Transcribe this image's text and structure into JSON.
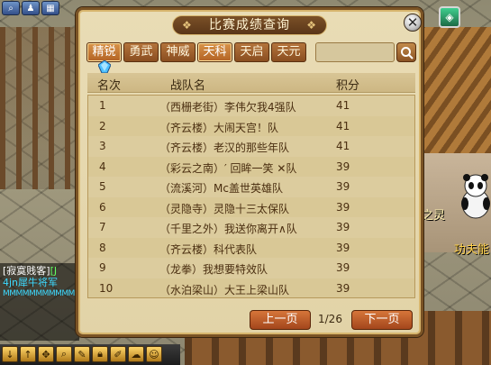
{
  "dialog": {
    "title": "比赛成绩查询",
    "close_label": "✕",
    "tabs": [
      {
        "label": "精锐",
        "active": true
      },
      {
        "label": "勇武",
        "active": false
      },
      {
        "label": "神威",
        "active": false
      },
      {
        "label": "天科",
        "active": true
      },
      {
        "label": "天启",
        "active": false
      },
      {
        "label": "天元",
        "active": false
      }
    ],
    "search": {
      "placeholder": "",
      "value": ""
    },
    "columns": {
      "rank": "名次",
      "team": "战队名",
      "score": "积分"
    },
    "rows": [
      {
        "rank": "1",
        "team": "（西栅老街）李伟欠我4强队",
        "score": "41"
      },
      {
        "rank": "2",
        "team": "（齐云楼）大闹天宫！队",
        "score": "41"
      },
      {
        "rank": "3",
        "team": "（齐云楼）老汉的那些年队",
        "score": "41"
      },
      {
        "rank": "4",
        "team": "（彩云之南）′ 回眸一笑 ✕队",
        "score": "39"
      },
      {
        "rank": "5",
        "team": "（流溪河）Mc盖世英雄队",
        "score": "39"
      },
      {
        "rank": "6",
        "team": "（灵隐寺）灵隐十三太保队",
        "score": "39"
      },
      {
        "rank": "7",
        "team": "（千里之外）我送你离开∧队",
        "score": "39"
      },
      {
        "rank": "8",
        "team": "（齐云楼）科代表队",
        "score": "39"
      },
      {
        "rank": "9",
        "team": "（龙拳）我想要特效队",
        "score": "39"
      },
      {
        "rank": "10",
        "team": "（水泊梁山）大王上梁山队",
        "score": "39"
      }
    ],
    "pagination": {
      "prev_label": "上一页",
      "next_label": "下一页",
      "page_text": "1/26"
    }
  },
  "scene": {
    "label1": "之灵",
    "label2": "功夫能"
  },
  "chat": {
    "line1_a": "[寂寞贱客]",
    "line1_b": "[J",
    "line2": "4jn犀牛将军",
    "line3": "MMMMMMMMMMMMMM"
  },
  "colors": {
    "dialog_bg": "#e9dcb5",
    "tab_bg": "#b3743c",
    "button_bg": "#d6763a",
    "header_bg": "#d8c595"
  }
}
